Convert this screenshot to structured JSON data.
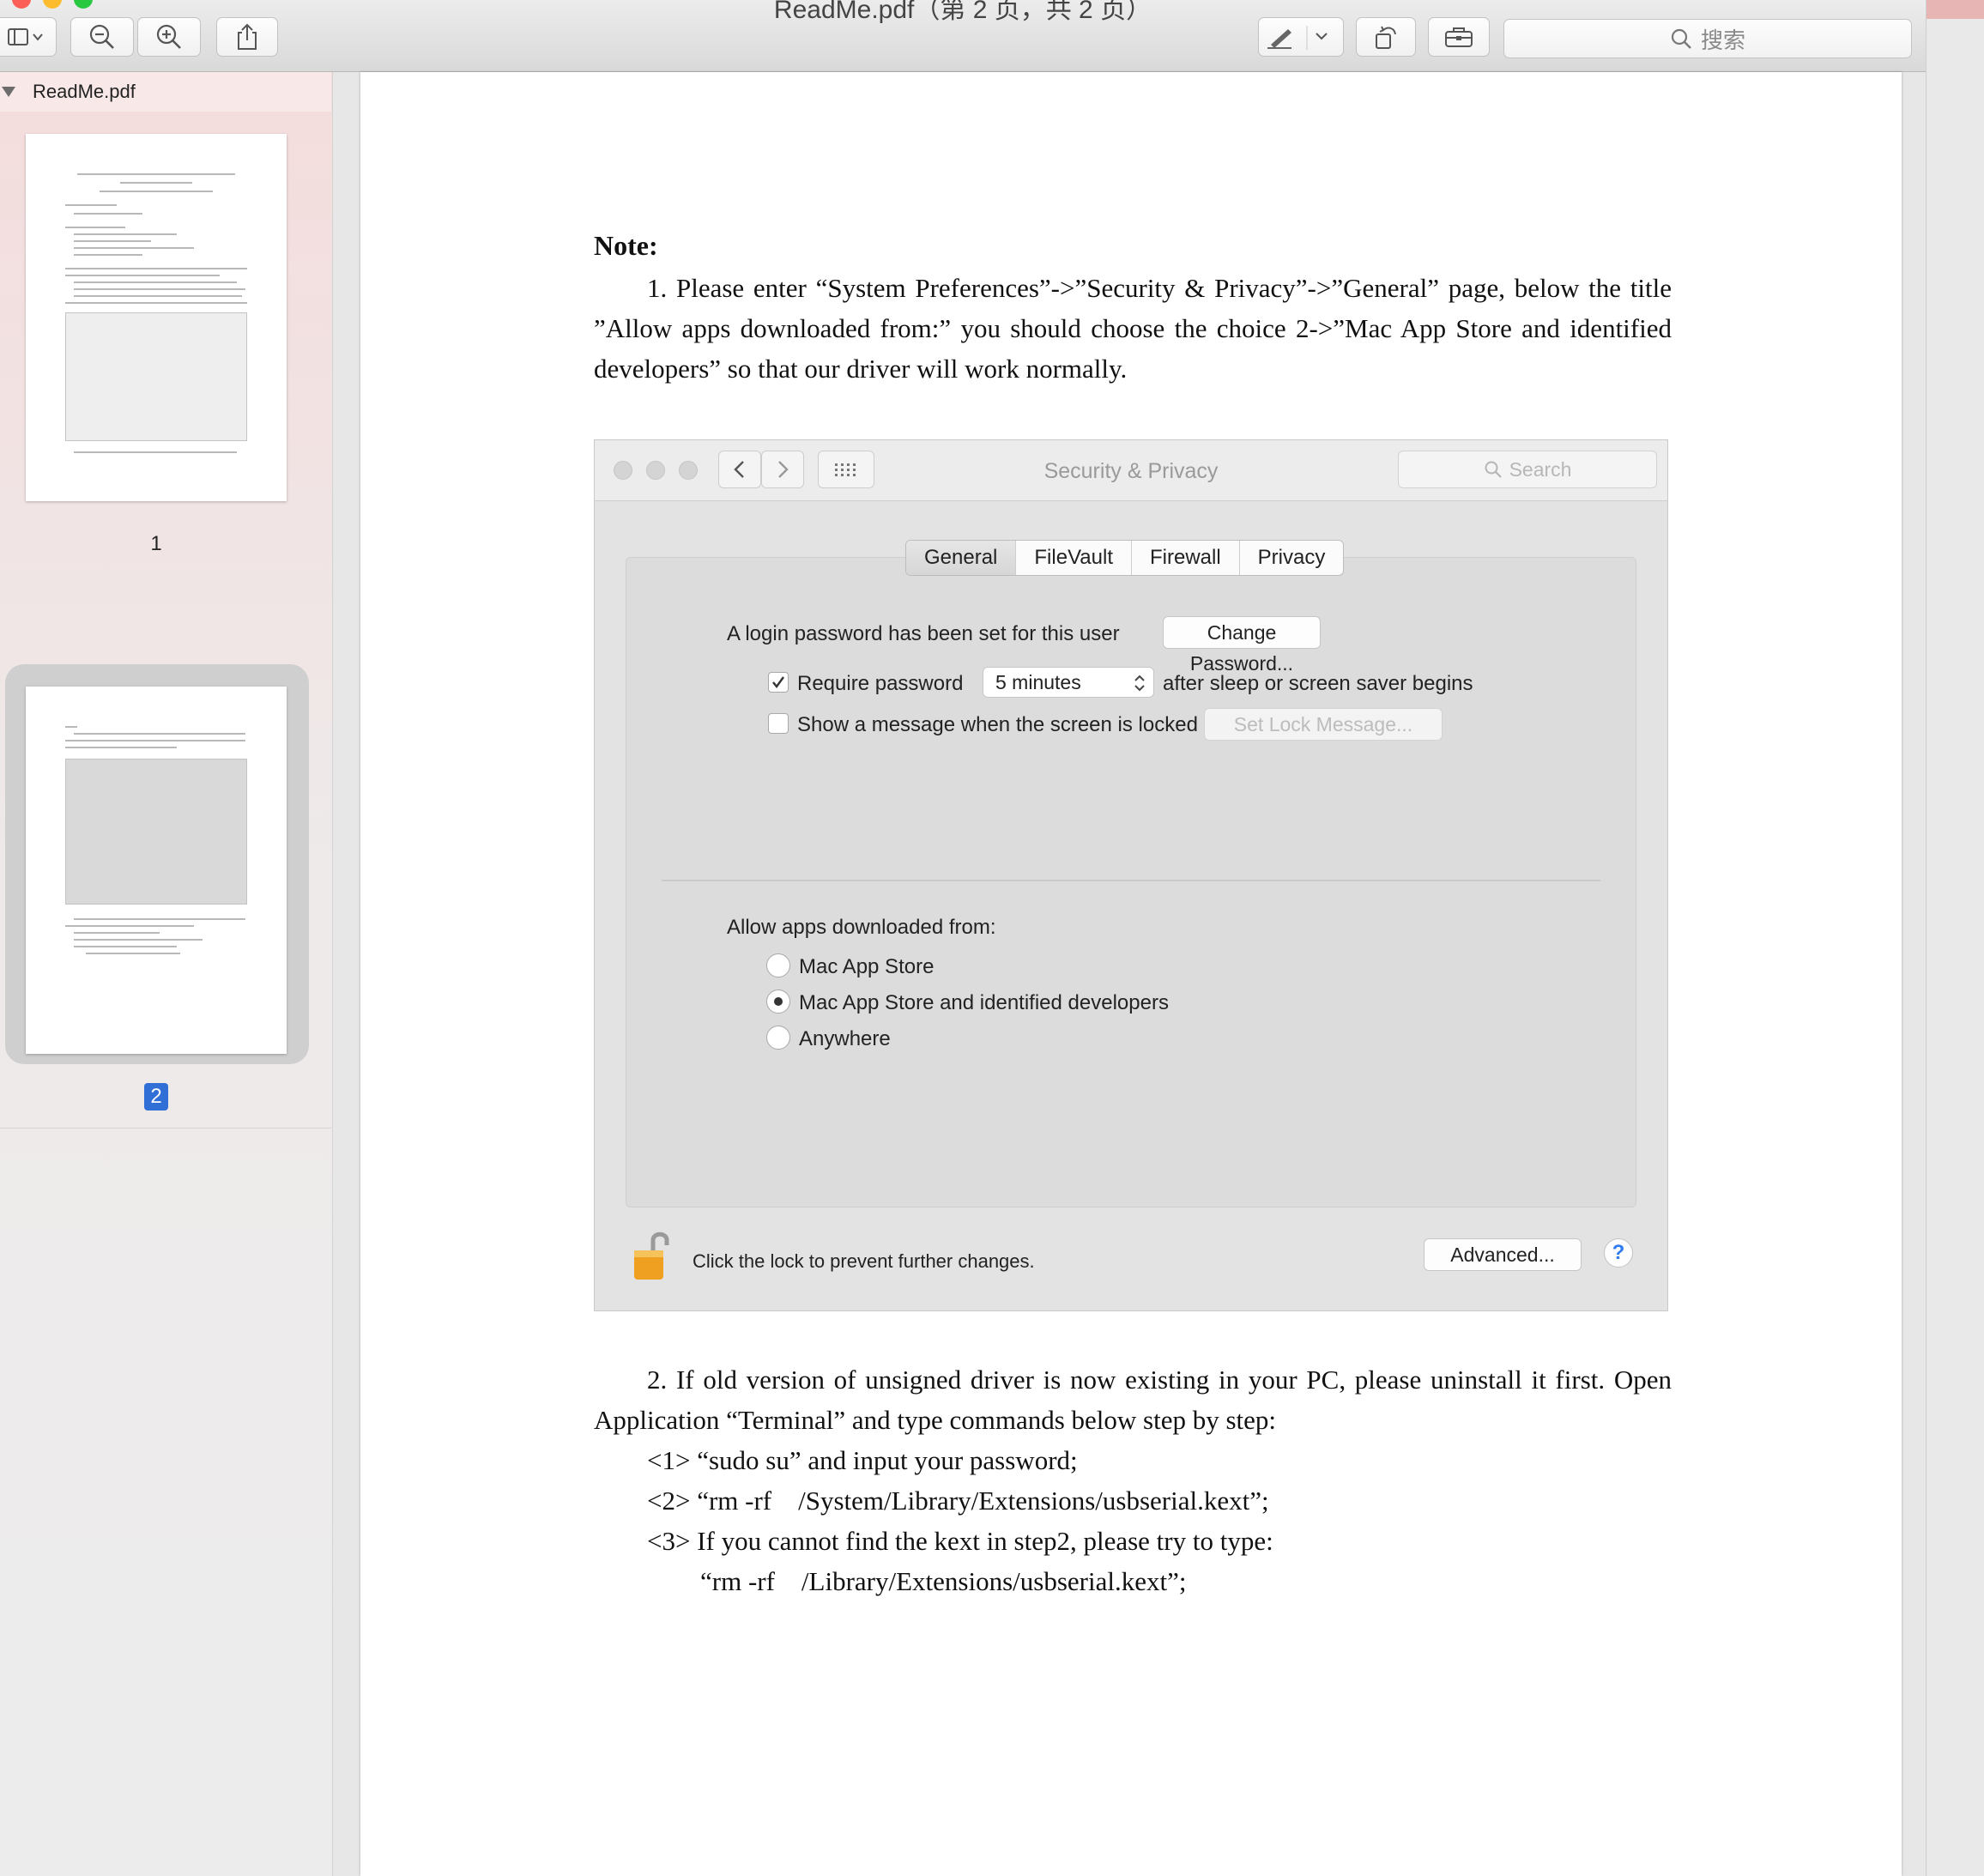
{
  "window": {
    "title": "ReadMe.pdf（第 2 页，共 2 页）"
  },
  "toolbar": {
    "search_placeholder": "搜索"
  },
  "sidebar": {
    "file_name": "ReadMe.pdf",
    "pages": [
      {
        "label": "1",
        "selected": false
      },
      {
        "label": "2",
        "selected": true
      }
    ]
  },
  "document": {
    "note_heading": "Note:",
    "paragraph1": "1. Please enter “System Preferences”->”Security & Privacy”->”General” page, below the title ”Allow apps downloaded from:” you should choose the choice 2->”Mac App Store and identified developers” so that our driver will work normally.",
    "paragraph2": "2. If old version of unsigned driver is now existing in your PC, please uninstall it first. Open Application “Terminal” and type commands below step by step:",
    "steps": [
      "<1> “sudo su” and input your password;",
      "<2> “rm -rf    /System/Library/Extensions/usbserial.kext”;",
      "<3> If you cannot find the kext in step2, please try to type:"
    ],
    "step3_command": "“rm -rf    /Library/Extensions/usbserial.kext”;"
  },
  "security_screenshot": {
    "title": "Security & Privacy",
    "search_placeholder": "Search",
    "tabs": [
      "General",
      "FileVault",
      "Firewall",
      "Privacy"
    ],
    "active_tab": "General",
    "login_text": "A login password has been set for this user",
    "change_password_button": "Change Password...",
    "require_password_label": "Require password",
    "require_password_checked": true,
    "require_password_interval": "5 minutes",
    "after_sleep_text": "after sleep or screen saver begins",
    "show_message_label": "Show a message when the screen is locked",
    "show_message_checked": false,
    "set_lock_message_button": "Set Lock Message...",
    "allow_apps_heading": "Allow apps downloaded from:",
    "allow_options": [
      "Mac App Store",
      "Mac App Store and identified developers",
      "Anywhere"
    ],
    "allow_selected": "Mac App Store and identified developers",
    "lock_text": "Click the lock to prevent further changes.",
    "advanced_button": "Advanced...",
    "help_button": "?"
  },
  "colors": {
    "accent": "#2f6fd6",
    "lock": "#f0a020"
  }
}
